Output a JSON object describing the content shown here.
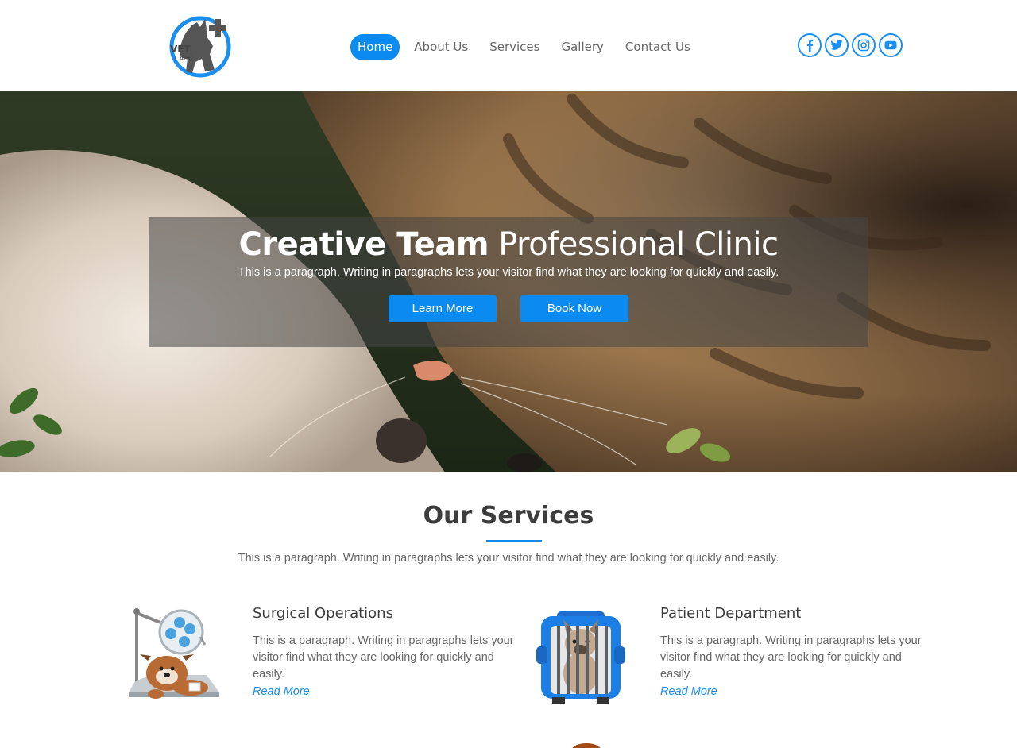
{
  "logo": {
    "line1": "VET",
    "line2": "CARE"
  },
  "nav": {
    "items": [
      {
        "label": "Home",
        "active": true
      },
      {
        "label": "About Us",
        "active": false
      },
      {
        "label": "Services",
        "active": false
      },
      {
        "label": "Gallery",
        "active": false
      },
      {
        "label": "Contact Us",
        "active": false
      }
    ]
  },
  "social": [
    "facebook-icon",
    "twitter-icon",
    "instagram-icon",
    "youtube-icon"
  ],
  "hero": {
    "title_bold": "Creative Team",
    "title_rest": "Professional Clinic",
    "subtitle": "This is a paragraph. Writing in paragraphs lets your visitor find what they are looking for quickly and easily.",
    "learn_more": "Learn More",
    "book_now": "Book Now"
  },
  "services": {
    "title": "Our Services",
    "subtitle": "This is a paragraph. Writing in paragraphs lets your visitor find what they are looking for quickly and easily.",
    "items": [
      {
        "name": "Surgical Operations",
        "text": "This is a paragraph. Writing in paragraphs lets your visitor find what they are looking for quickly and easily.",
        "link": "Read More"
      },
      {
        "name": "Patient Department",
        "text": "This is a paragraph. Writing in paragraphs lets your visitor find what they are looking for quickly and easily.",
        "link": "Read More"
      }
    ]
  },
  "colors": {
    "accent": "#0b8bef",
    "heading": "#3d3d3d",
    "body_text": "#666666"
  }
}
